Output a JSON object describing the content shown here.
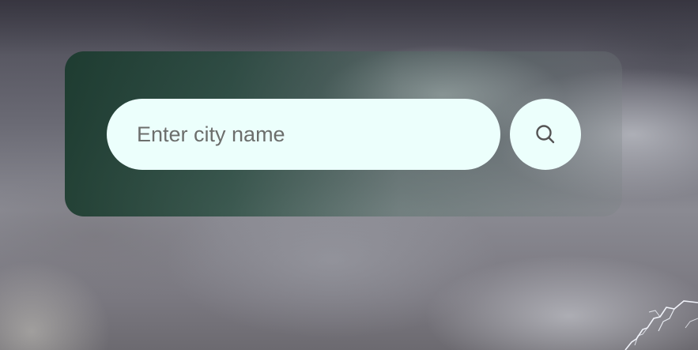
{
  "search": {
    "placeholder": "Enter city name",
    "value": "",
    "button_icon": "search-icon"
  },
  "colors": {
    "panel": "#1f4a3a",
    "input_background": "#ecfffc",
    "placeholder_text": "#6c6e6c",
    "icon": "#555555"
  }
}
